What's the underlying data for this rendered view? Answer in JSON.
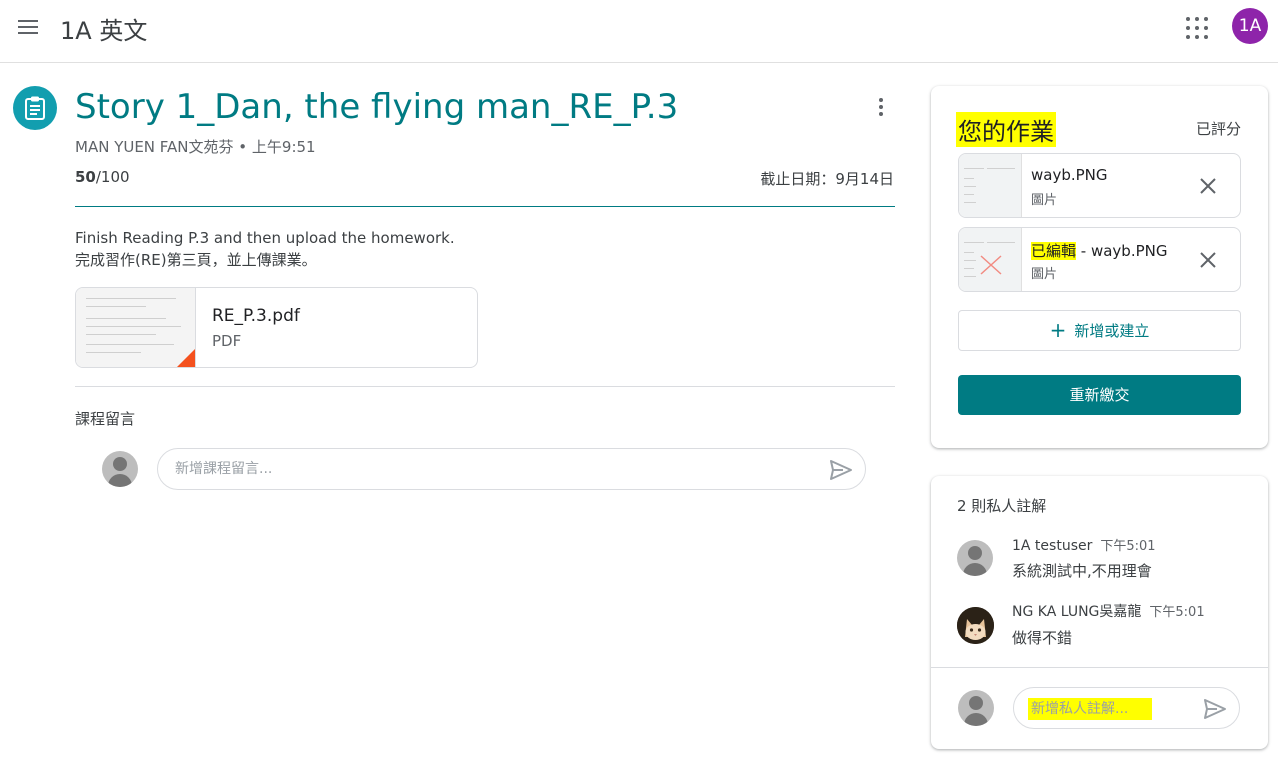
{
  "header": {
    "app_title": "1A 英文",
    "user_initials": "1A",
    "avatar_color": "#8e24aa"
  },
  "assignment": {
    "title": "Story 1_Dan, the flying man_RE_P.3",
    "meta": "MAN YUEN FAN文苑芬 • 上午9:51",
    "points_earned": "50",
    "points_total": "/100",
    "due": "截止日期：9月14日",
    "instructions_line1": "Finish Reading P.3 and then upload the homework.",
    "instructions_line2": "完成習作(RE)第三頁，並上傳課業。",
    "attachment": {
      "name": "RE_P.3.pdf",
      "type": "PDF"
    },
    "accent_color": "#007b83"
  },
  "class_comments": {
    "label": "課程留言",
    "placeholder": "新增課程留言..."
  },
  "your_work": {
    "title": "您的作業",
    "status": "已評分",
    "files": [
      {
        "highlight": "",
        "name": "wayb.PNG",
        "type": "圖片"
      },
      {
        "highlight": "已編輯",
        "name": " - wayb.PNG",
        "type": "圖片"
      }
    ],
    "add_label": "新增或建立",
    "resubmit_label": "重新繳交"
  },
  "private_comments": {
    "count_label": "2 則私人註解",
    "comments": [
      {
        "author": "1A testuser",
        "time": "下午5:01",
        "text": "系統測試中,不用理會"
      },
      {
        "author": "NG KA LUNG吳嘉龍",
        "time": "下午5:01",
        "text": "做得不錯"
      }
    ],
    "placeholder": "新增私人註解..."
  }
}
